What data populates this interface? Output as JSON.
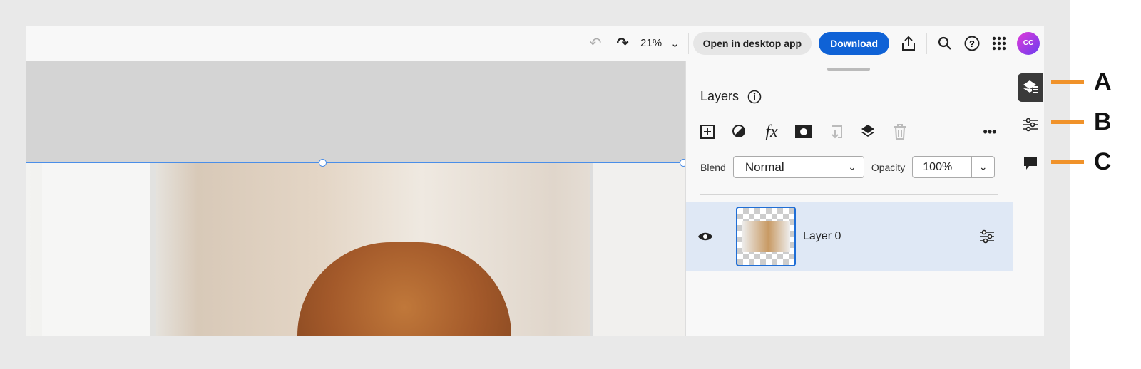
{
  "toolbar": {
    "zoom": "21%",
    "open_desktop": "Open in desktop app",
    "download": "Download",
    "avatar": "CC"
  },
  "layers_panel": {
    "title": "Layers",
    "blend_label": "Blend",
    "blend_value": "Normal",
    "opacity_label": "Opacity",
    "opacity_value": "100%",
    "layers": [
      {
        "name": "Layer 0",
        "visible": true,
        "selected": true
      }
    ]
  },
  "callouts": [
    "A",
    "B",
    "C"
  ],
  "colors": {
    "accent": "#0f62d6",
    "callout": "#f0922a",
    "selected_row": "#dfe8f5"
  }
}
